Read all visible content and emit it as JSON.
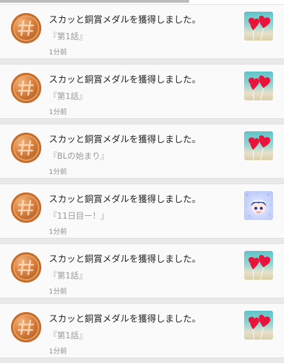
{
  "notifications": [
    {
      "message": "スカッと銅賞メダルを獲得しました。",
      "episode": "『第1話』",
      "time": "1分前",
      "medal_icon": "bronze-medal-icon",
      "thumbnail": "hearts"
    },
    {
      "message": "スカッと銅賞メダルを獲得しました。",
      "episode": "『第1話』",
      "time": "1分前",
      "medal_icon": "bronze-medal-icon",
      "thumbnail": "hearts"
    },
    {
      "message": "スカッと銅賞メダルを獲得しました。",
      "episode": "『BLの始まり』",
      "time": "1分前",
      "medal_icon": "bronze-medal-icon",
      "thumbnail": "hearts"
    },
    {
      "message": "スカッと銅賞メダルを獲得しました。",
      "episode": "『11日目ー！』",
      "time": "1分前",
      "medal_icon": "bronze-medal-icon",
      "thumbnail": "anime-character"
    },
    {
      "message": "スカッと銅賞メダルを獲得しました。",
      "episode": "『第1話』",
      "time": "1分前",
      "medal_icon": "bronze-medal-icon",
      "thumbnail": "hearts"
    },
    {
      "message": "スカッと銅賞メダルを獲得しました。",
      "episode": "『第1話』",
      "time": "1分前",
      "medal_icon": "bronze-medal-icon",
      "thumbnail": "hearts"
    }
  ],
  "colors": {
    "medal_bronze": "#c97634",
    "background": "#e9e9e9",
    "card": "#fafafa"
  }
}
